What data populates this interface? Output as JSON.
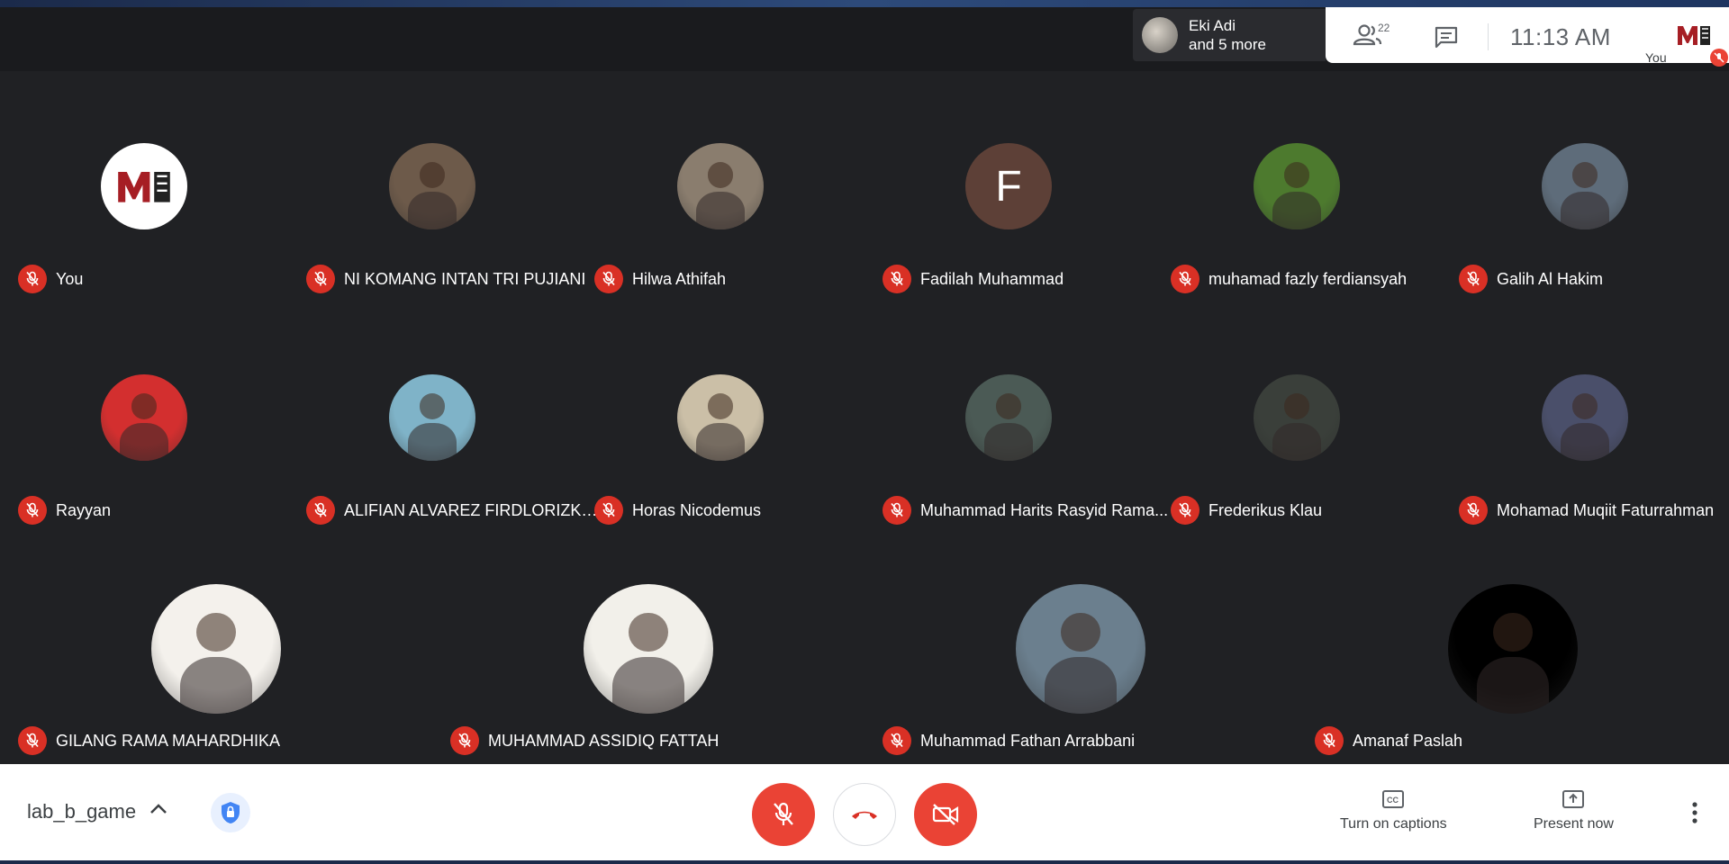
{
  "topbar": {
    "presenter_line1": "Eki Adi",
    "presenter_line2": "and 5 more",
    "people_count": "22",
    "time": "11:13  AM",
    "self_label": "You"
  },
  "participants": [
    {
      "name": "You",
      "avatar": "logo"
    },
    {
      "name": "NI KOMANG INTAN TRI PUJIANI",
      "avatar": "photo"
    },
    {
      "name": "Hilwa Athifah",
      "avatar": "photo"
    },
    {
      "name": "Fadilah Muhammad",
      "avatar": "initial",
      "initial": "F"
    },
    {
      "name": "muhamad fazly ferdiansyah",
      "avatar": "photo"
    },
    {
      "name": "Galih Al Hakim",
      "avatar": "photo"
    },
    {
      "name": "Rayyan",
      "avatar": "photo"
    },
    {
      "name": "ALIFIAN ALVAREZ FIRDLORIZKY S",
      "avatar": "photo"
    },
    {
      "name": "Horas Nicodemus",
      "avatar": "photo"
    },
    {
      "name": "Muhammad Harits Rasyid Rama...",
      "avatar": "photo"
    },
    {
      "name": "Frederikus Klau",
      "avatar": "photo"
    },
    {
      "name": "Mohamad Muqiit Faturrahman",
      "avatar": "photo"
    },
    {
      "name": "GILANG RAMA MAHARDHIKA",
      "avatar": "photo"
    },
    {
      "name": "MUHAMMAD ASSIDIQ FATTAH",
      "avatar": "photo"
    },
    {
      "name": "Muhammad Fathan Arrabbani",
      "avatar": "photo"
    },
    {
      "name": "Amanaf Paslah",
      "avatar": "photo"
    }
  ],
  "bottombar": {
    "meeting_name": "lab_b_game",
    "captions_label": "Turn on captions",
    "present_label": "Present now"
  },
  "colors": {
    "background": "#202124",
    "mic_off": "#d93025",
    "end_call": "#ea4335",
    "bar": "#ffffff"
  }
}
